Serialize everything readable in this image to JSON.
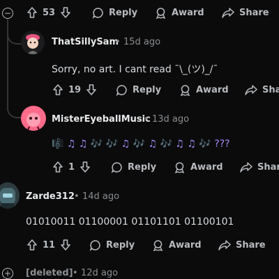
{
  "actions": {
    "reply": "Reply",
    "award": "Award",
    "share": "Share"
  },
  "comments": [
    {
      "username": "",
      "time": "",
      "text": "",
      "votes": "53"
    },
    {
      "username": "ThatSillySam",
      "time": "15d ago",
      "text": "Sorry, no art. I cant read ¯\\_(ツ)_/¯",
      "votes": "19"
    },
    {
      "username": "MisterEyeballMusic",
      "time": "13d ago",
      "text": "🎼 ♫ ♫ 🎶 🎶 ♫ 🎶 ♫ 🎶 ♫ ♫ 🎶 ???",
      "votes": "1"
    },
    {
      "username": "Zarde312",
      "time": "14d ago",
      "text": "01010011 01100001 01101101 01100101",
      "votes": "11"
    },
    {
      "username": "[deleted]",
      "time": "12d ago",
      "text": "",
      "votes": ""
    }
  ],
  "separator": "•",
  "colors": {
    "background": "#0b0b0c",
    "thread_line": "#343536",
    "muted": "#8b8e90"
  }
}
